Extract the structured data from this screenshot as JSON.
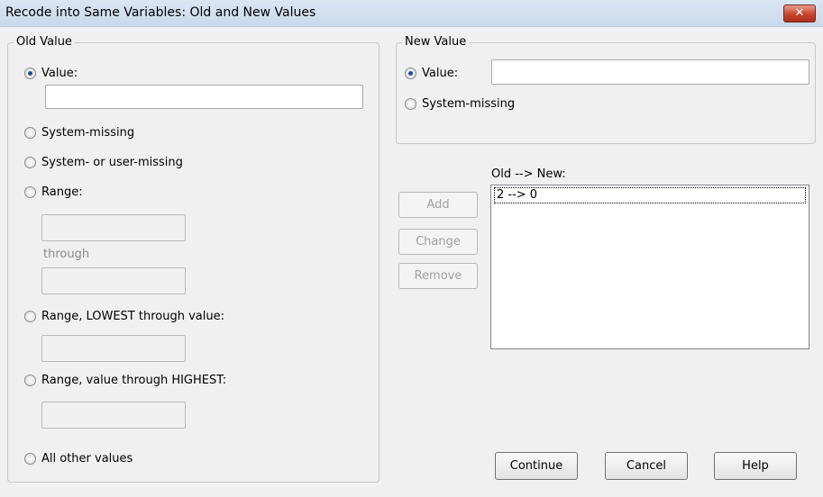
{
  "window": {
    "title": "Recode into Same Variables: Old and New Values",
    "close_glyph": "✕"
  },
  "old_value": {
    "group_title": "Old Value",
    "value_label": "Value:",
    "system_missing_label": "System-missing",
    "system_or_user_missing_label": "System- or user-missing",
    "range_label": "Range:",
    "through_label": "through",
    "range_lowest_label": "Range, LOWEST through value:",
    "range_highest_label": "Range, value through HIGHEST:",
    "all_other_label": "All other values"
  },
  "new_value": {
    "group_title": "New Value",
    "value_label": "Value:",
    "system_missing_label": "System-missing"
  },
  "mapping": {
    "list_label": "Old --> New:",
    "items": [
      "2 --> 0"
    ]
  },
  "buttons": {
    "add": "Add",
    "change": "Change",
    "remove": "Remove",
    "continue": "Continue",
    "cancel": "Cancel",
    "help": "Help"
  }
}
